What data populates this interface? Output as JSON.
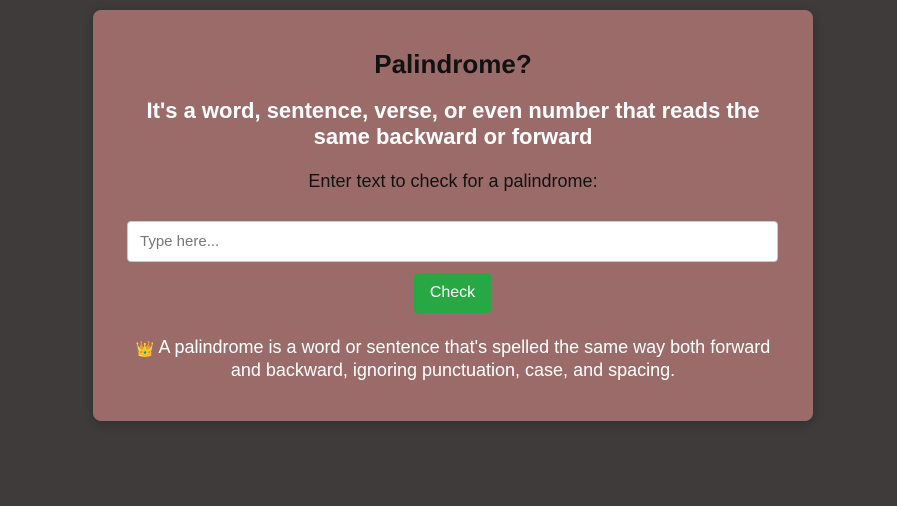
{
  "card": {
    "title": "Palindrome?",
    "subtitle": "It's a word, sentence, verse, or even number that reads the same backward or forward",
    "prompt": "Enter text to check for a palindrome:",
    "input": {
      "value": "",
      "placeholder": "Type here..."
    },
    "check_label": "Check",
    "info_icon": "crown-icon",
    "info_icon_glyph": "👑",
    "info_text": "A palindrome is a word or sentence that's spelled the same way both forward and backward, ignoring punctuation, case, and spacing."
  },
  "colors": {
    "page_background": "#3f3b3a",
    "card_background": "#9a6b68",
    "button_background": "#28a745"
  }
}
